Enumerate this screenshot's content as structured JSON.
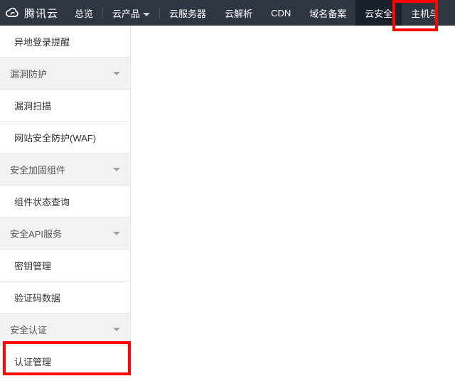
{
  "brand": "腾讯云",
  "nav": {
    "overview": "总览",
    "products": "云产品",
    "cvm": "云服务器",
    "dns": "云解析",
    "cdn": "CDN",
    "beian": "域名备案",
    "security": "云安全",
    "host": "主机与"
  },
  "sidebar": {
    "item_remote_login": "异地登录提醒",
    "group_vuln": "漏洞防护",
    "item_vuln_scan": "漏洞扫描",
    "item_waf": "网站安全防护(WAF)",
    "group_harden": "安全加固组件",
    "item_component_status": "组件状态查询",
    "group_api": "安全API服务",
    "item_key_mgmt": "密钥管理",
    "item_captcha": "验证码数据",
    "group_auth": "安全认证",
    "item_cert_mgmt": "认证管理"
  }
}
